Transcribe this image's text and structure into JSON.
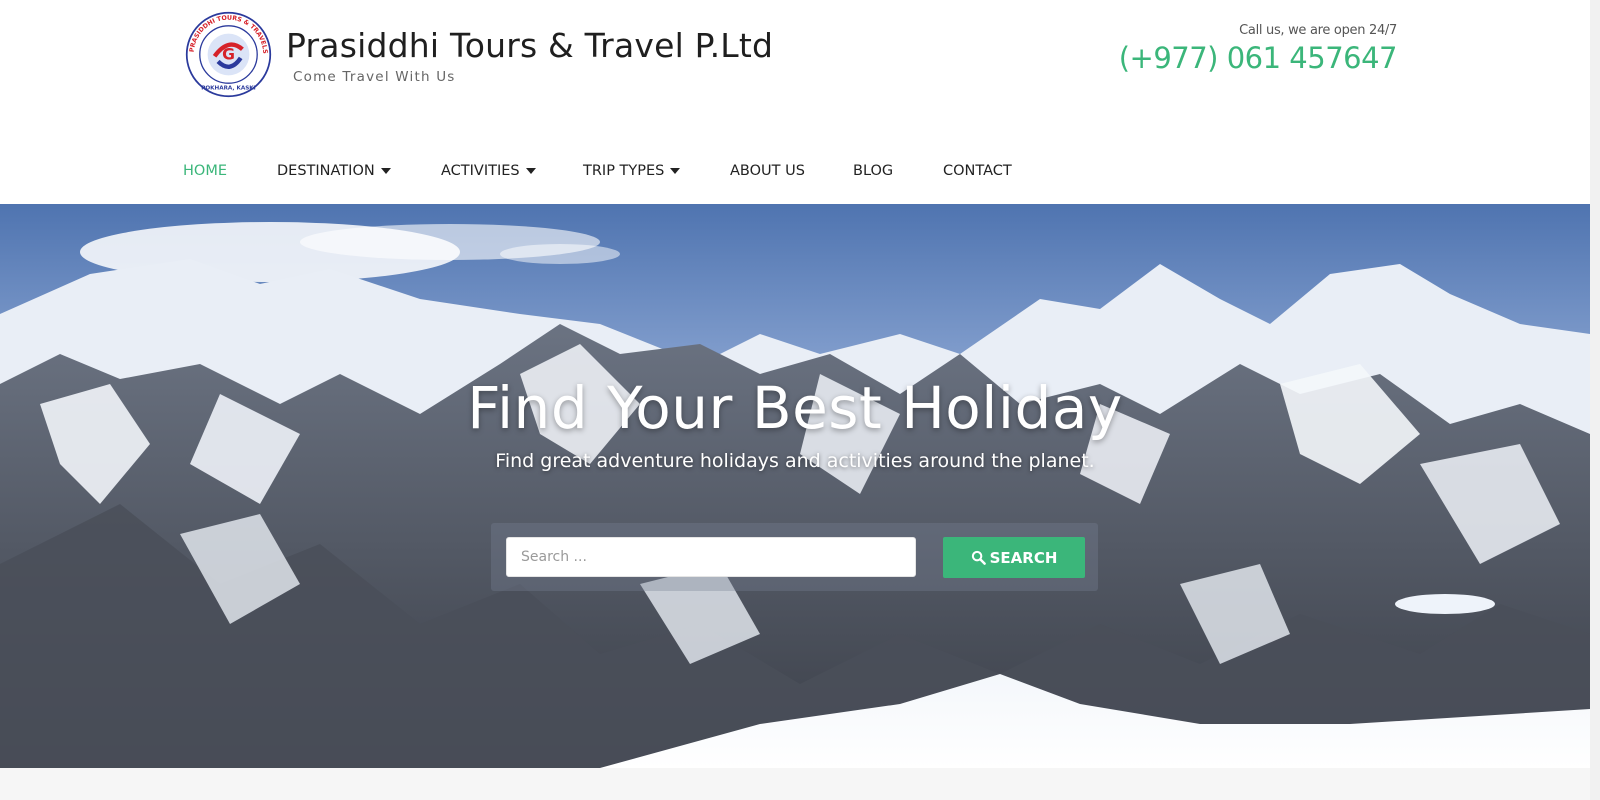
{
  "header": {
    "site_title": "Prasiddhi Tours & Travel P.Ltd",
    "tagline": "Come Travel With Us",
    "logo_ring_text": "PRASIDDHI TOURS & TRAVELS (P.) LTD",
    "logo_bottom_text": "POKHARA, KASKI",
    "call_label": "Call us, we are open 24/7",
    "phone": "(+977) 061 457647"
  },
  "nav": {
    "items": [
      {
        "label": "HOME",
        "active": true,
        "dropdown": false
      },
      {
        "label": "DESTINATION",
        "active": false,
        "dropdown": true
      },
      {
        "label": "ACTIVITIES",
        "active": false,
        "dropdown": true
      },
      {
        "label": "TRIP TYPES",
        "active": false,
        "dropdown": true
      },
      {
        "label": "ABOUT US",
        "active": false,
        "dropdown": false
      },
      {
        "label": "BLOG",
        "active": false,
        "dropdown": false
      },
      {
        "label": "CONTACT",
        "active": false,
        "dropdown": false
      }
    ]
  },
  "hero": {
    "title": "Find Your Best Holiday",
    "subtitle": "Find great adventure holidays and activities around the planet.",
    "search_placeholder": "Search ...",
    "search_button_label": "SEARCH",
    "search_icon": "search-icon"
  },
  "colors": {
    "accent": "#3bb67a",
    "text_dark": "#222222"
  }
}
